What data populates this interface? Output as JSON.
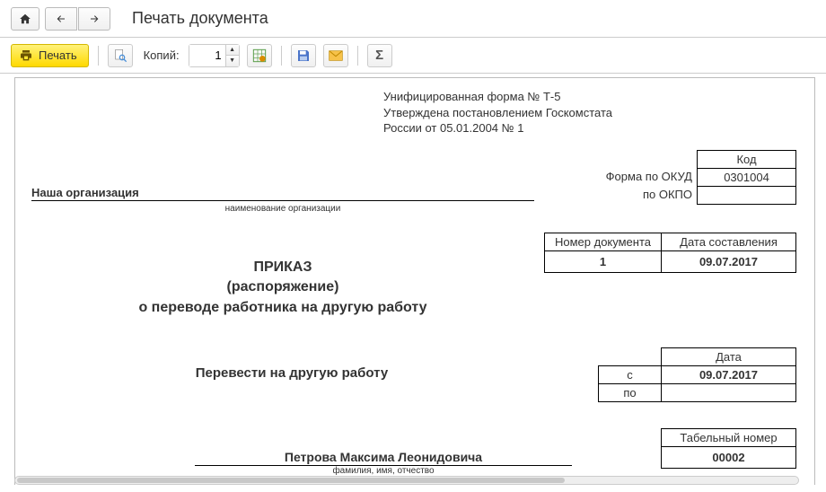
{
  "window": {
    "title": "Печать документа"
  },
  "toolbar": {
    "print_label": "Печать",
    "copies_label": "Копий:",
    "copies_value": "1"
  },
  "doc": {
    "form_meta_l1": "Унифицированная форма № Т-5",
    "form_meta_l2": "Утверждена постановлением Госкомстата",
    "form_meta_l3": "России от 05.01.2004 № 1",
    "kod_header": "Код",
    "okud_label": "Форма по ОКУД",
    "okud_value": "0301004",
    "okpo_label": "по ОКПО",
    "okpo_value": "",
    "org_name": "Наша организация",
    "org_caption": "наименование организации",
    "numdoc_header": "Номер документа",
    "date_header": "Дата составления",
    "numdoc_value": "1",
    "date_value": "09.07.2017",
    "prikaz_l1": "ПРИКАЗ",
    "prikaz_l2": "(распоряжение)",
    "prikaz_l3": "о переводе работника на другую работу",
    "date2_header": "Дата",
    "date2_from_lbl": "с",
    "date2_from_val": "09.07.2017",
    "date2_to_lbl": "по",
    "date2_to_val": "",
    "transfer_line": "Перевести на другую работу",
    "tabnum_header": "Табельный номер",
    "tabnum_value": "00002",
    "fio": "Петрова Максима Леонидовича",
    "fio_caption": "фамилия, имя, отчество"
  }
}
